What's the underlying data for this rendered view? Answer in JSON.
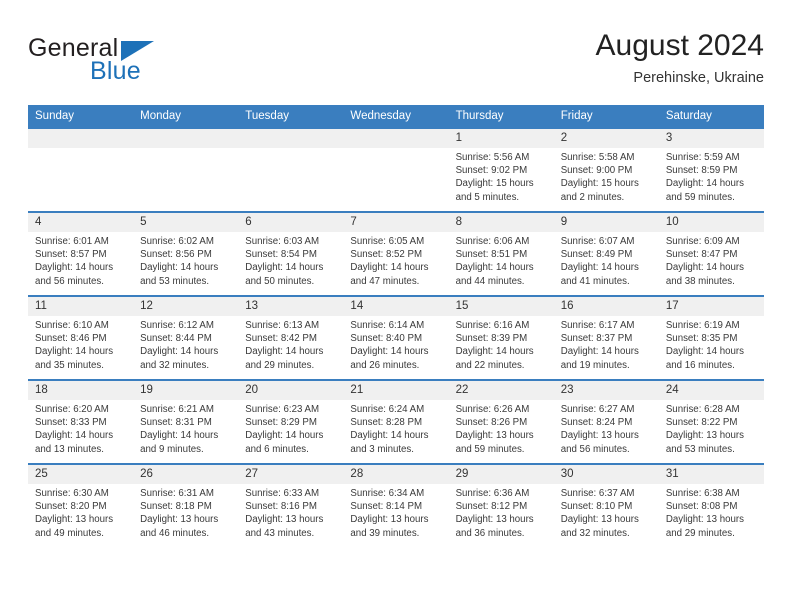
{
  "brand": {
    "name_top": "General",
    "name_bottom": "Blue",
    "triangle_color": "#1d71b8"
  },
  "header": {
    "title": "August 2024",
    "subtitle": "Perehinske, Ukraine"
  },
  "theme": {
    "header_bg": "#3a7ebf",
    "header_text": "#ffffff",
    "daynum_bg": "#f0f0f0",
    "cell_border": "#3a7ebf"
  },
  "weekday_headers": [
    "Sunday",
    "Monday",
    "Tuesday",
    "Wednesday",
    "Thursday",
    "Friday",
    "Saturday"
  ],
  "labels": {
    "sunrise_prefix": "Sunrise:",
    "sunset_prefix": "Sunset:",
    "daylight_prefix": "Daylight:"
  },
  "weeks": [
    [
      {
        "day": "",
        "empty": true,
        "sunrise": "",
        "sunset": "",
        "daylight": ""
      },
      {
        "day": "",
        "empty": true,
        "sunrise": "",
        "sunset": "",
        "daylight": ""
      },
      {
        "day": "",
        "empty": true,
        "sunrise": "",
        "sunset": "",
        "daylight": ""
      },
      {
        "day": "",
        "empty": true,
        "sunrise": "",
        "sunset": "",
        "daylight": ""
      },
      {
        "day": "1",
        "empty": false,
        "sunrise": "Sunrise: 5:56 AM",
        "sunset": "Sunset: 9:02 PM",
        "daylight": "Daylight: 15 hours and 5 minutes."
      },
      {
        "day": "2",
        "empty": false,
        "sunrise": "Sunrise: 5:58 AM",
        "sunset": "Sunset: 9:00 PM",
        "daylight": "Daylight: 15 hours and 2 minutes."
      },
      {
        "day": "3",
        "empty": false,
        "sunrise": "Sunrise: 5:59 AM",
        "sunset": "Sunset: 8:59 PM",
        "daylight": "Daylight: 14 hours and 59 minutes."
      }
    ],
    [
      {
        "day": "4",
        "empty": false,
        "sunrise": "Sunrise: 6:01 AM",
        "sunset": "Sunset: 8:57 PM",
        "daylight": "Daylight: 14 hours and 56 minutes."
      },
      {
        "day": "5",
        "empty": false,
        "sunrise": "Sunrise: 6:02 AM",
        "sunset": "Sunset: 8:56 PM",
        "daylight": "Daylight: 14 hours and 53 minutes."
      },
      {
        "day": "6",
        "empty": false,
        "sunrise": "Sunrise: 6:03 AM",
        "sunset": "Sunset: 8:54 PM",
        "daylight": "Daylight: 14 hours and 50 minutes."
      },
      {
        "day": "7",
        "empty": false,
        "sunrise": "Sunrise: 6:05 AM",
        "sunset": "Sunset: 8:52 PM",
        "daylight": "Daylight: 14 hours and 47 minutes."
      },
      {
        "day": "8",
        "empty": false,
        "sunrise": "Sunrise: 6:06 AM",
        "sunset": "Sunset: 8:51 PM",
        "daylight": "Daylight: 14 hours and 44 minutes."
      },
      {
        "day": "9",
        "empty": false,
        "sunrise": "Sunrise: 6:07 AM",
        "sunset": "Sunset: 8:49 PM",
        "daylight": "Daylight: 14 hours and 41 minutes."
      },
      {
        "day": "10",
        "empty": false,
        "sunrise": "Sunrise: 6:09 AM",
        "sunset": "Sunset: 8:47 PM",
        "daylight": "Daylight: 14 hours and 38 minutes."
      }
    ],
    [
      {
        "day": "11",
        "empty": false,
        "sunrise": "Sunrise: 6:10 AM",
        "sunset": "Sunset: 8:46 PM",
        "daylight": "Daylight: 14 hours and 35 minutes."
      },
      {
        "day": "12",
        "empty": false,
        "sunrise": "Sunrise: 6:12 AM",
        "sunset": "Sunset: 8:44 PM",
        "daylight": "Daylight: 14 hours and 32 minutes."
      },
      {
        "day": "13",
        "empty": false,
        "sunrise": "Sunrise: 6:13 AM",
        "sunset": "Sunset: 8:42 PM",
        "daylight": "Daylight: 14 hours and 29 minutes."
      },
      {
        "day": "14",
        "empty": false,
        "sunrise": "Sunrise: 6:14 AM",
        "sunset": "Sunset: 8:40 PM",
        "daylight": "Daylight: 14 hours and 26 minutes."
      },
      {
        "day": "15",
        "empty": false,
        "sunrise": "Sunrise: 6:16 AM",
        "sunset": "Sunset: 8:39 PM",
        "daylight": "Daylight: 14 hours and 22 minutes."
      },
      {
        "day": "16",
        "empty": false,
        "sunrise": "Sunrise: 6:17 AM",
        "sunset": "Sunset: 8:37 PM",
        "daylight": "Daylight: 14 hours and 19 minutes."
      },
      {
        "day": "17",
        "empty": false,
        "sunrise": "Sunrise: 6:19 AM",
        "sunset": "Sunset: 8:35 PM",
        "daylight": "Daylight: 14 hours and 16 minutes."
      }
    ],
    [
      {
        "day": "18",
        "empty": false,
        "sunrise": "Sunrise: 6:20 AM",
        "sunset": "Sunset: 8:33 PM",
        "daylight": "Daylight: 14 hours and 13 minutes."
      },
      {
        "day": "19",
        "empty": false,
        "sunrise": "Sunrise: 6:21 AM",
        "sunset": "Sunset: 8:31 PM",
        "daylight": "Daylight: 14 hours and 9 minutes."
      },
      {
        "day": "20",
        "empty": false,
        "sunrise": "Sunrise: 6:23 AM",
        "sunset": "Sunset: 8:29 PM",
        "daylight": "Daylight: 14 hours and 6 minutes."
      },
      {
        "day": "21",
        "empty": false,
        "sunrise": "Sunrise: 6:24 AM",
        "sunset": "Sunset: 8:28 PM",
        "daylight": "Daylight: 14 hours and 3 minutes."
      },
      {
        "day": "22",
        "empty": false,
        "sunrise": "Sunrise: 6:26 AM",
        "sunset": "Sunset: 8:26 PM",
        "daylight": "Daylight: 13 hours and 59 minutes."
      },
      {
        "day": "23",
        "empty": false,
        "sunrise": "Sunrise: 6:27 AM",
        "sunset": "Sunset: 8:24 PM",
        "daylight": "Daylight: 13 hours and 56 minutes."
      },
      {
        "day": "24",
        "empty": false,
        "sunrise": "Sunrise: 6:28 AM",
        "sunset": "Sunset: 8:22 PM",
        "daylight": "Daylight: 13 hours and 53 minutes."
      }
    ],
    [
      {
        "day": "25",
        "empty": false,
        "sunrise": "Sunrise: 6:30 AM",
        "sunset": "Sunset: 8:20 PM",
        "daylight": "Daylight: 13 hours and 49 minutes."
      },
      {
        "day": "26",
        "empty": false,
        "sunrise": "Sunrise: 6:31 AM",
        "sunset": "Sunset: 8:18 PM",
        "daylight": "Daylight: 13 hours and 46 minutes."
      },
      {
        "day": "27",
        "empty": false,
        "sunrise": "Sunrise: 6:33 AM",
        "sunset": "Sunset: 8:16 PM",
        "daylight": "Daylight: 13 hours and 43 minutes."
      },
      {
        "day": "28",
        "empty": false,
        "sunrise": "Sunrise: 6:34 AM",
        "sunset": "Sunset: 8:14 PM",
        "daylight": "Daylight: 13 hours and 39 minutes."
      },
      {
        "day": "29",
        "empty": false,
        "sunrise": "Sunrise: 6:36 AM",
        "sunset": "Sunset: 8:12 PM",
        "daylight": "Daylight: 13 hours and 36 minutes."
      },
      {
        "day": "30",
        "empty": false,
        "sunrise": "Sunrise: 6:37 AM",
        "sunset": "Sunset: 8:10 PM",
        "daylight": "Daylight: 13 hours and 32 minutes."
      },
      {
        "day": "31",
        "empty": false,
        "sunrise": "Sunrise: 6:38 AM",
        "sunset": "Sunset: 8:08 PM",
        "daylight": "Daylight: 13 hours and 29 minutes."
      }
    ]
  ]
}
